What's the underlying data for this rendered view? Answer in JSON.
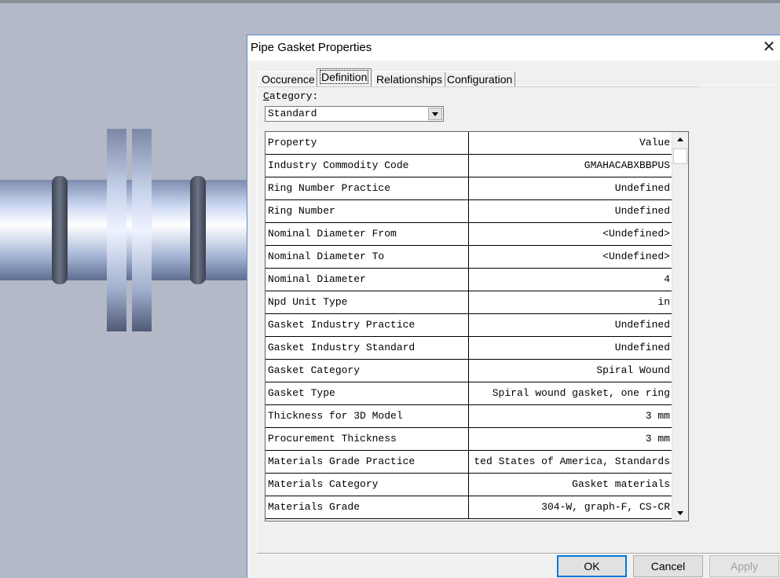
{
  "dialog": {
    "title": "Pipe Gasket Properties",
    "close_glyph": "✕"
  },
  "tabs": [
    {
      "label": "Occurence",
      "active": false
    },
    {
      "label": "Definition",
      "active": true
    },
    {
      "label": "Relationships",
      "active": false
    },
    {
      "label": "Configuration",
      "active": false
    }
  ],
  "category": {
    "label_prefix": "",
    "label_underlined": "C",
    "label_rest": "ategory:",
    "selected": "Standard"
  },
  "grid": {
    "header": {
      "property": "Property",
      "value": "Value"
    },
    "rows": [
      {
        "property": "Industry Commodity Code",
        "value": "GMAHACABXBBPUS"
      },
      {
        "property": "Ring Number Practice",
        "value": "Undefined"
      },
      {
        "property": "Ring Number",
        "value": "Undefined"
      },
      {
        "property": "Nominal Diameter From",
        "value": "<Undefined>"
      },
      {
        "property": "Nominal Diameter To",
        "value": "<Undefined>"
      },
      {
        "property": "Nominal Diameter",
        "value": "4"
      },
      {
        "property": "Npd Unit Type",
        "value": "in"
      },
      {
        "property": "Gasket Industry Practice",
        "value": "Undefined"
      },
      {
        "property": "Gasket Industry Standard",
        "value": "Undefined"
      },
      {
        "property": "Gasket Category",
        "value": "Spiral Wound"
      },
      {
        "property": "Gasket Type",
        "value": "Spiral wound gasket, one ring"
      },
      {
        "property": "Thickness for 3D Model",
        "value": "3 mm"
      },
      {
        "property": "Procurement Thickness",
        "value": "3 mm"
      },
      {
        "property": "Materials Grade Practice",
        "value": "ted States of America, Standards"
      },
      {
        "property": "Materials Category",
        "value": "Gasket materials"
      },
      {
        "property": "Materials Grade",
        "value": "304-W, graph-F, CS-CR"
      }
    ]
  },
  "buttons": {
    "ok": "OK",
    "cancel": "Cancel",
    "apply": "Apply"
  },
  "colors": {
    "background": "#b3b9c6",
    "dialog_border": "#5b8ec7",
    "pipe_light": "#e8f0ff",
    "pipe_dark": "#6e7fa6",
    "flange_ring": "#4a5060"
  },
  "icons": {
    "combo_arrow": "chevron-down-icon",
    "scroll_up": "scroll-up-icon",
    "scroll_down": "scroll-down-icon",
    "close": "close-icon"
  }
}
